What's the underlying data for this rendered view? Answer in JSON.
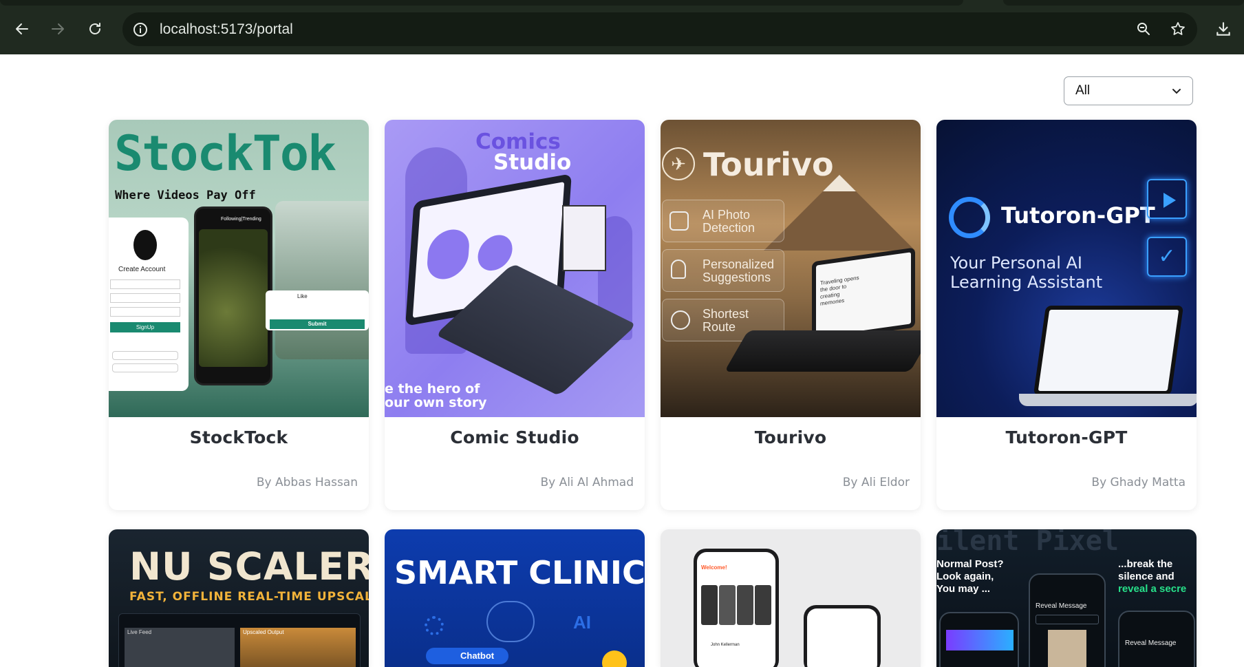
{
  "browser": {
    "url": "localhost:5173/portal",
    "back_icon": "arrow-left-icon",
    "forward_icon": "arrow-right-icon",
    "reload_icon": "reload-icon",
    "site_info_icon": "info-circle-icon",
    "zoom_icon": "zoom-icon",
    "bookmark_icon": "star-icon",
    "download_icon": "download-icon"
  },
  "filter": {
    "selected": "All"
  },
  "projects": [
    {
      "title": "StockTock",
      "author": "By Abbas Hassan",
      "thumb": {
        "brand": "StockTok",
        "tagline": "Where Videos Pay Off",
        "create_account": "Create Account",
        "signup": "SignUp",
        "following_trending": "Following|Trending",
        "like": "Like",
        "submit": "Submit"
      },
      "colors": {
        "bg": "#a9cbbc",
        "accent": "#1a8a70"
      }
    },
    {
      "title": "Comic Studio",
      "author": "By Ali Al Ahmad",
      "thumb": {
        "brand_line1": "Comics",
        "brand_line2": "Studio",
        "tagline_line1": "e the hero of",
        "tagline_line2": "our own story"
      },
      "colors": {
        "bg": "#9b8cf0",
        "accent": "#6f58e6"
      }
    },
    {
      "title": "Tourivo",
      "author": "By Ali Eldor",
      "thumb": {
        "brand": "Tourivo",
        "features": [
          "AI Photo Detection",
          "Personalized Suggestions",
          "Shortest Route"
        ],
        "screen_text": "Traveling opens the door to creating memories"
      },
      "colors": {
        "bg": "#8a6a45",
        "accent": "#d9b27a"
      }
    },
    {
      "title": "Tutoron-GPT",
      "author": "By Ghady Matta",
      "thumb": {
        "brand": "Tutoron-GPT",
        "tagline_line1": "Your Personal AI",
        "tagline_line2": "Learning Assistant"
      },
      "colors": {
        "bg": "#0b1a4a",
        "accent": "#2f8cff"
      }
    },
    {
      "title": "",
      "author": "",
      "thumb": {
        "brand": "NU SCALER",
        "tagline": "FAST, OFFLINE REAL-TIME UPSCALER",
        "panel1": "Live Feed",
        "panel2": "Upscaled Output"
      },
      "colors": {
        "bg": "#16202a",
        "accent": "#f2b33a"
      }
    },
    {
      "title": "",
      "author": "",
      "thumb": {
        "brand": "SMART CLINIC",
        "chip": "Chatbot",
        "ai_label": "AI"
      },
      "colors": {
        "bg": "#0c3aa8",
        "accent": "#ffffff"
      }
    },
    {
      "title": "",
      "author": "",
      "thumb": {
        "welcome": "Welcome!",
        "user": "John Kellerman"
      },
      "colors": {
        "bg": "#e9e9ea",
        "accent": "#ff5a2a"
      }
    },
    {
      "title": "",
      "author": "",
      "thumb": {
        "brand": "ilent Pixel",
        "left_line1": "Normal Post?",
        "left_line2": "Look again,",
        "left_line3": "You may ...",
        "right_line1": "...break the",
        "right_line2": "silence and",
        "right_line3": "reveal a secre",
        "reveal1": "Reveal Message",
        "reveal2": "Reveal Message"
      },
      "colors": {
        "bg": "#0e1822",
        "accent": "#27e08a"
      }
    }
  ]
}
